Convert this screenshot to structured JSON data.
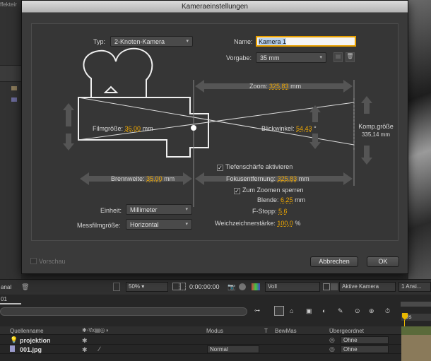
{
  "dialog": {
    "title": "Kameraeinstellungen",
    "typ_label": "Typ:",
    "typ_value": "2-Knoten-Kamera",
    "name_label": "Name:",
    "name_value": "Kamera 1",
    "vorgabe_label": "Vorgabe:",
    "vorgabe_value": "35 mm",
    "zoom_label": "Zoom:",
    "zoom_value": "325,83",
    "zoom_unit": "mm",
    "filmgroesse_label": "Filmgröße:",
    "filmgroesse_value": "36,00",
    "filmgroesse_unit": "mm",
    "blickwinkel_label": "Blickwinkel:",
    "blickwinkel_value": "54,43",
    "blickwinkel_unit": "°",
    "komp_label": "Komp.größe",
    "komp_value": "335,14 mm",
    "brennweite_label": "Brennweite:",
    "brennweite_value": "35,00",
    "brennweite_unit": "mm",
    "tiefenschaerfe_label": "Tiefenschärfe aktivieren",
    "fokus_label": "Fokusentfernung:",
    "fokus_value": "325,83",
    "fokus_unit": "mm",
    "zoomen_label": "Zum Zoomen sperren",
    "blende_label": "Blende:",
    "blende_value": "6,25",
    "blende_unit": "mm",
    "fstopp_label": "F-Stopp:",
    "fstopp_value": "5,6",
    "weich_label": "Weichzeichnerstärke:",
    "weich_value": "100,0",
    "weich_unit": "%",
    "einheit_label": "Einheit:",
    "einheit_value": "Millimeter",
    "messfilm_label": "Messfilmgröße:",
    "messfilm_value": "Horizontal",
    "vorschau_label": "Vorschau",
    "abbrechen_label": "Abbrechen",
    "ok_label": "OK"
  },
  "background": {
    "effekte_label": "ffekteir",
    "kanal_label": "anal",
    "zoom_pct": "50%",
    "timecode": "0:00:00:00",
    "voll": "Voll",
    "aktive_kamera": "Aktive Kamera",
    "ansicht": "1 Ansi...",
    "tab_label": "01",
    "time_marker": "0s",
    "columns": {
      "quellenname": "Quellenname",
      "modus": "Modus",
      "t": "T",
      "bewmas": "BewMas",
      "uebergeordnet": "Übergeordnet"
    },
    "layers": [
      {
        "name": "projektion",
        "parent": "Ohne"
      },
      {
        "name": "001.jpg",
        "mode": "Normal",
        "parent": "Ohne"
      }
    ]
  },
  "colors": {
    "accent": "#f0a800",
    "dialog_bg": "#3a3a3a",
    "panel_bg": "#333333"
  }
}
